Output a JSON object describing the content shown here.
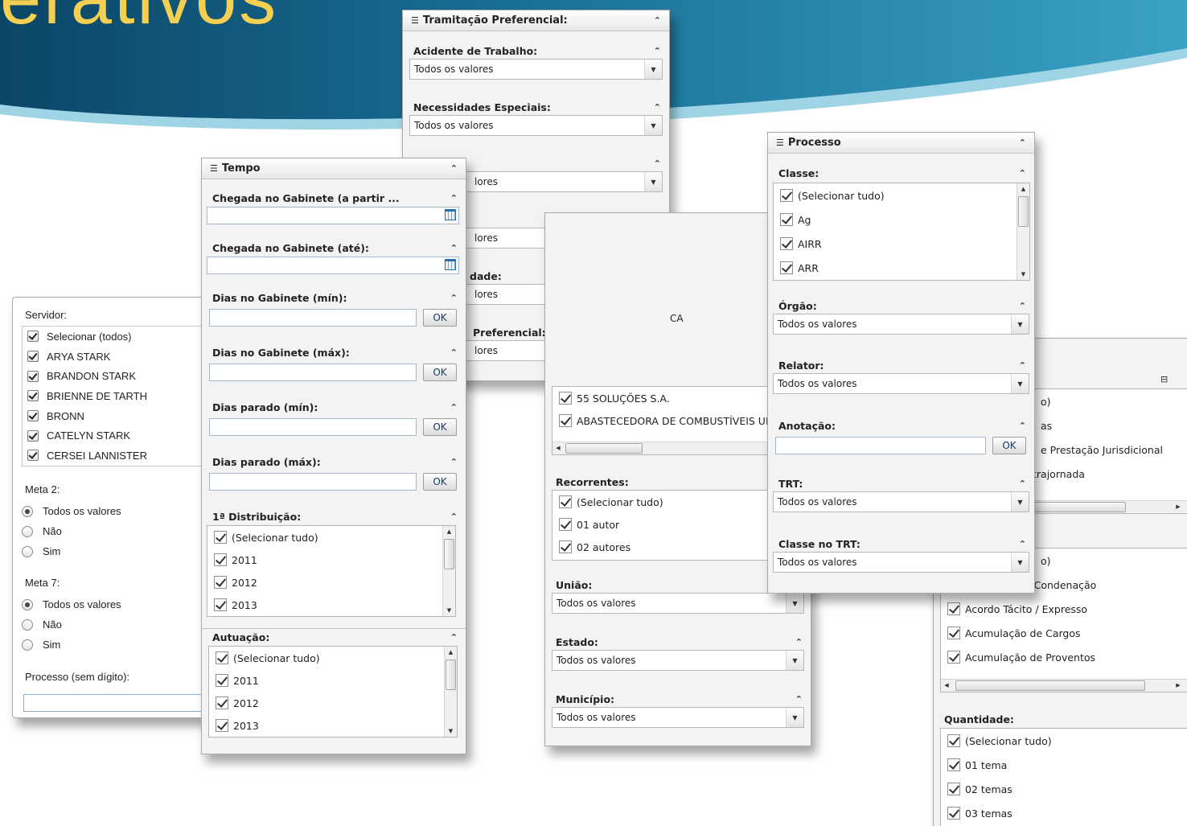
{
  "slide": {
    "title": "erativos"
  },
  "colors": {
    "banner_dark": "#0b4666",
    "banner_mid": "#1f7ea3",
    "banner_light": "#3aa2c4",
    "title_yellow": "#f5cf52",
    "panel_bg": "#f3f3f3"
  },
  "servidor": {
    "servidor_label": "Servidor:",
    "items": [
      "Selecionar (todos)",
      "ARYA STARK",
      "BRANDON STARK",
      "BRIENNE DE TARTH",
      "BRONN",
      "CATELYN STARK",
      "CERSEI LANNISTER"
    ],
    "meta2_label": "Meta 2:",
    "meta2_options": [
      "Todos os valores",
      "Não",
      "Sim"
    ],
    "meta7_label": "Meta 7:",
    "meta7_options": [
      "Todos os valores",
      "Não",
      "Sim"
    ],
    "processo_label": "Processo (sem dígito):"
  },
  "tempo": {
    "title": "Tempo",
    "chegada_de": "Chegada no Gabinete (a partir ...",
    "chegada_ate": "Chegada no Gabinete (até):",
    "dias_gab_min": "Dias no Gabinete (mín):",
    "dias_gab_max": "Dias no Gabinete (máx):",
    "dias_par_min": "Dias parado (mín):",
    "dias_par_max": "Dias parado (máx):",
    "ok": "OK",
    "dist_label": "1ª Distribuição:",
    "dist_items": [
      "(Selecionar tudo)",
      "2011",
      "2012",
      "2013"
    ],
    "atu_label": "Autuação:",
    "atu_items": [
      "(Selecionar tudo)",
      "2011",
      "2012",
      "2013"
    ]
  },
  "tramitacao": {
    "title": "Tramitação Preferencial:",
    "acidente": "Acidente de Trabalho:",
    "necessidades": "Necessidades Especiais:",
    "all_values": "Todos os valores",
    "partial_values": "lores",
    "partial_dade": "dade:",
    "partial_pref": "Preferencial:"
  },
  "middle": {
    "partial_ca": "CA",
    "items": [
      "55 SOLUÇÕES S.A.",
      "ABASTECEDORA DE COMBUSTÍVEIS UNIOI"
    ],
    "recorrentes_label": "Recorrentes:",
    "recorrentes_items": [
      "(Selecionar tudo)",
      "01 autor",
      "02 autores"
    ],
    "uniao": "União:",
    "estado": "Estado:",
    "municipio": "Município:",
    "all_values": "Todos os valores"
  },
  "processo": {
    "title": "Processo",
    "classe_label": "Classe:",
    "classe_items": [
      "(Selecionar tudo)",
      "Ag",
      "AIRR",
      "ARR"
    ],
    "orgao": "Órgão:",
    "relator": "Relator:",
    "anotacao": "Anotação:",
    "trt": "TRT:",
    "classe_trt": "Classe no TRT:",
    "all_values": "Todos os valores",
    "ok": "OK"
  },
  "right": {
    "partial_items_top": [
      "o)",
      "as",
      "e Prestação Jurisdicional",
      "trajornada"
    ],
    "partial_items_mid": [
      "o)",
      "a Condenação"
    ],
    "items_mid": [
      "Acordo Tácito / Expresso",
      "Acumulação de Cargos",
      "Acumulação de Proventos"
    ],
    "quantidade_label": "Quantidade:",
    "quantidade_items": [
      "(Selecionar tudo)",
      "01 tema",
      "02 temas",
      "03 temas"
    ]
  }
}
